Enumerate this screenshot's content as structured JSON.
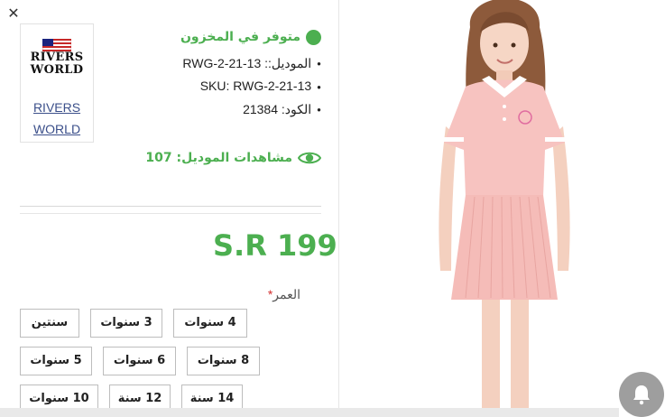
{
  "brand": {
    "logo_line1": "RIVERS",
    "logo_line2": "WORLD",
    "link_line1": "RIVERS",
    "link_line2": "WORLD"
  },
  "stock": {
    "label": "متوفر في المخزون",
    "color": "#4caf50"
  },
  "details": {
    "model": "الموديل:: RWG-2-21-13",
    "sku": "SKU: RWG-2-21-13",
    "code": "الكود: 21384"
  },
  "views": {
    "label": "مشاهدات الموديل: 107"
  },
  "price": {
    "value": "S.R 199"
  },
  "age": {
    "label": "العمر",
    "required_mark": "*",
    "options": [
      "سنتين",
      "3 سنوات",
      "4 سنوات",
      "5 سنوات",
      "6 سنوات",
      "8 سنوات",
      "10 سنوات",
      "12 سنة",
      "14 سنة"
    ]
  },
  "icons": {
    "close": "close-icon",
    "eye": "eye-icon",
    "bell": "bell-icon",
    "flag": "flag-icon"
  },
  "colors": {
    "accent": "#4caf50",
    "required": "#d32f2f",
    "dress": "#f7c3c0"
  }
}
